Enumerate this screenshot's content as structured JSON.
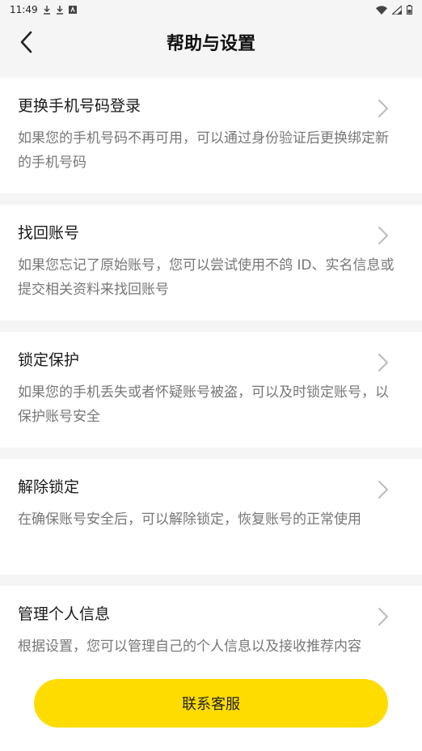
{
  "status": {
    "time": "11:49"
  },
  "header": {
    "title": "帮助与设置"
  },
  "items": [
    {
      "title": "更换手机号码登录",
      "desc": "如果您的手机号码不再可用，可以通过身份验证后更换绑定新的手机号码"
    },
    {
      "title": "找回账号",
      "desc": "如果您忘记了原始账号，您可以尝试使用不鸽 ID、实名信息或提交相关资料来找回账号"
    },
    {
      "title": "锁定保护",
      "desc": "如果您的手机丢失或者怀疑账号被盗，可以及时锁定账号，以保护账号安全"
    },
    {
      "title": "解除锁定",
      "desc": "在确保账号安全后，可以解除锁定，恢复账号的正常使用"
    },
    {
      "title": "管理个人信息",
      "desc": "根据设置，您可以管理自己的个人信息以及接收推荐内容"
    }
  ],
  "footer": {
    "contact_label": "联系客服"
  },
  "colors": {
    "accent": "#ffdc00",
    "background": "#f5f5f5"
  }
}
